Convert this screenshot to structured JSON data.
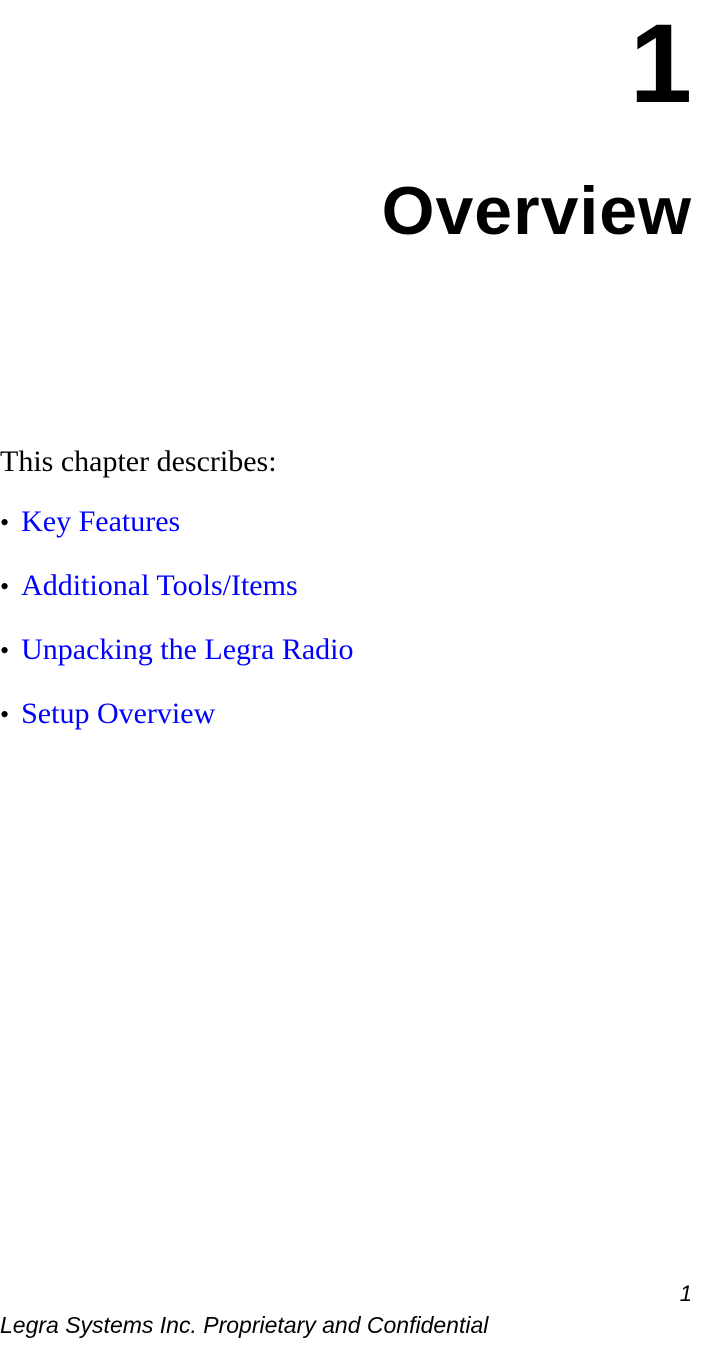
{
  "chapter": {
    "number": "1",
    "title": "Overview"
  },
  "intro": "This chapter describes:",
  "links": [
    "Key Features",
    "Additional Tools/Items",
    "Unpacking the Legra Radio",
    "Setup Overview"
  ],
  "footer": {
    "pageNumber": "1",
    "confidential": "Legra Systems Inc. Proprietary and Confidential"
  }
}
